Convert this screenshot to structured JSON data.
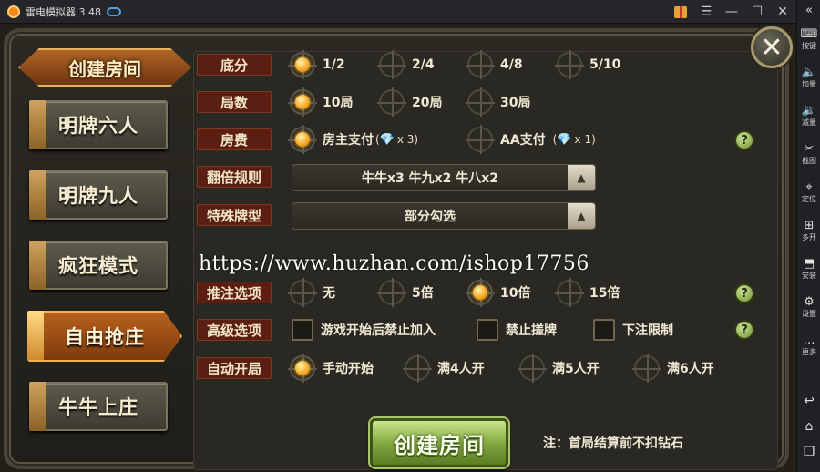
{
  "window": {
    "title": "雷电模拟器 3.48"
  },
  "sidebar": {
    "items": [
      {
        "icon": "keyboard-icon",
        "glyph": "⌨",
        "label": "按键"
      },
      {
        "icon": "volume-up-icon",
        "glyph": "🔈",
        "label": "加量"
      },
      {
        "icon": "volume-down-icon",
        "glyph": "🔉",
        "label": "减量"
      },
      {
        "icon": "scissors-icon",
        "glyph": "✂",
        "label": "截图"
      },
      {
        "icon": "location-icon",
        "glyph": "⌖",
        "label": "定位"
      },
      {
        "icon": "multi-open-icon",
        "glyph": "⊞",
        "label": "多开"
      },
      {
        "icon": "install-icon",
        "glyph": "⬒",
        "label": "安装"
      },
      {
        "icon": "settings-icon",
        "glyph": "⚙",
        "label": "设置"
      },
      {
        "icon": "more-icon",
        "glyph": "…",
        "label": "更多"
      }
    ],
    "bottom": [
      {
        "icon": "back-icon",
        "glyph": "↩"
      },
      {
        "icon": "home-icon",
        "glyph": "⌂"
      },
      {
        "icon": "recent-apps-icon",
        "glyph": "❐"
      }
    ]
  },
  "left_menu": {
    "header": "创建房间",
    "modes": [
      "明牌六人",
      "明牌九人",
      "疯狂模式",
      "自由抢庄",
      "牛牛上庄"
    ],
    "active_mode": "自由抢庄"
  },
  "settings": {
    "base_score": {
      "label": "底分",
      "options": [
        "1/2",
        "2/4",
        "4/8",
        "5/10"
      ],
      "selected": "1/2"
    },
    "rounds": {
      "label": "局数",
      "options": [
        "10局",
        "20局",
        "30局"
      ],
      "selected": "10局"
    },
    "room_fee": {
      "label": "房费",
      "options": [
        {
          "text": "房主支付",
          "cost": "x 3)",
          "cost_prefix": "("
        },
        {
          "text": "AA支付",
          "cost": "x 1)",
          "cost_prefix": "("
        }
      ],
      "selected": "房主支付"
    },
    "double_rule": {
      "label": "翻倍规则",
      "value": "牛牛x3  牛九x2  牛八x2"
    },
    "special_cards": {
      "label": "特殊牌型",
      "value": "部分勾选"
    },
    "bet_push": {
      "label": "推注选项",
      "options": [
        "无",
        "5倍",
        "10倍",
        "15倍"
      ],
      "selected": "10倍"
    },
    "advanced": {
      "label": "高级选项",
      "options": [
        "游戏开始后禁止加入",
        "禁止搓牌",
        "下注限制"
      ],
      "checked": []
    },
    "auto_start": {
      "label": "自动开局",
      "options": [
        "手动开始",
        "满4人开",
        "满5人开",
        "满6人开"
      ],
      "selected": "手动开始"
    }
  },
  "watermark": "https://www.huzhan.com/ishop17756",
  "create_button": "创建房间",
  "note": "注：首局结算前不扣钻石",
  "colors": {
    "accent_orange": "#b7611e",
    "radio_selected": "#f6a61d",
    "create_green": "#7fa43c",
    "label_bg": "#5a1f12"
  }
}
